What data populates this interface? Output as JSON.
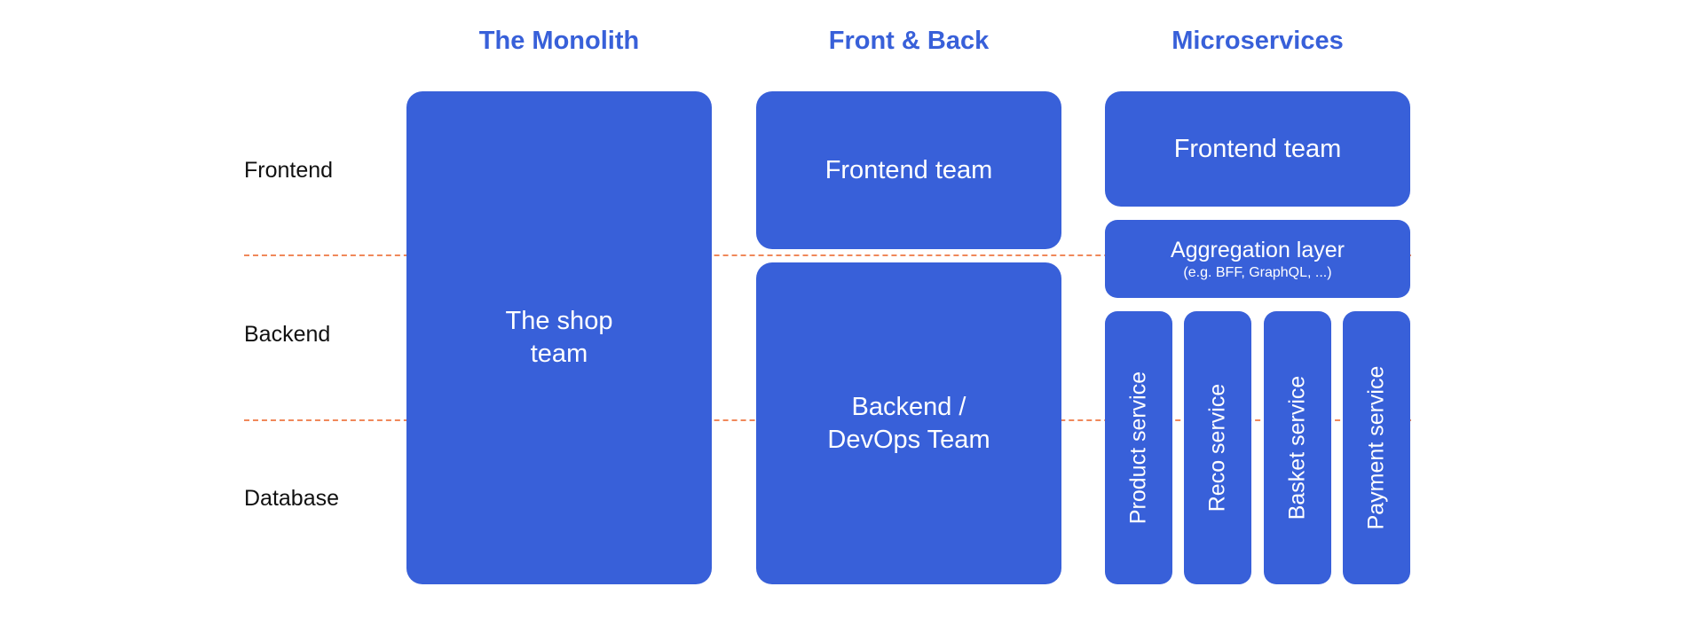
{
  "columns": [
    {
      "title": "The Monolith"
    },
    {
      "title": "Front & Back"
    },
    {
      "title": "Microservices"
    }
  ],
  "rows": [
    "Frontend",
    "Backend",
    "Database"
  ],
  "monolith": {
    "team": "The shop\nteam"
  },
  "front_back": {
    "frontend": "Frontend team",
    "backend_line1": "Backend /",
    "backend_line2": "DevOps Team"
  },
  "microservices": {
    "frontend": "Frontend team",
    "aggregation": "Aggregation layer",
    "aggregation_sub": "(e.g. BFF, GraphQL, ...)",
    "services": [
      "Product service",
      "Reco service",
      "Basket service",
      "Payment service"
    ]
  },
  "colors": {
    "accent": "#3860d9",
    "divider": "#f0885a"
  }
}
